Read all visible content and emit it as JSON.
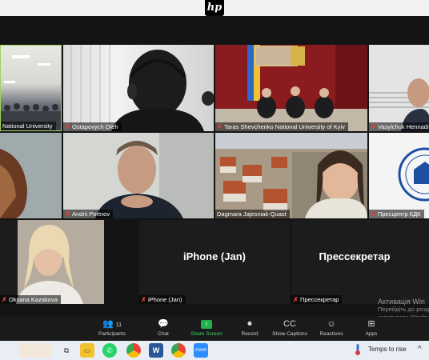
{
  "participants": {
    "p1": {
      "name": "National University"
    },
    "p2": {
      "name": "Ostapovych Oleh"
    },
    "p3": {
      "name": "Taras Shevchenko National University of Kyiv"
    },
    "p4": {
      "name": "Vasylchuk Hennadi"
    },
    "p5": {
      "name": ""
    },
    "p6": {
      "name": "Andrii Portnov"
    },
    "p7": {
      "name": "Dagmara Jajesniak-Quast"
    },
    "p8": {
      "name": "Пресцентр КДК"
    },
    "p9": {
      "name": "Oksana Kazakova"
    },
    "p10": {
      "name": "iPhone (Jan)",
      "big": "iPhone (Jan)"
    },
    "p11": {
      "name": "Прессекретар",
      "big": "Прессекретар"
    }
  },
  "toolbar": {
    "participants_count": "11",
    "participants": "Participants",
    "chat": "Chat",
    "share": "Share Screen",
    "record": "Record",
    "captions": "Show Captions",
    "reactions": "Reactions",
    "apps": "Apps"
  },
  "activation": {
    "title": "Активація Win",
    "line1": "Перейдіть до розділу",
    "line2": "активувати Windows."
  },
  "taskbar": {
    "weather": "Temps to rise"
  },
  "colors": {
    "share_green": "#21b04b",
    "active_speaker": "#9fd35a",
    "mic_muted": "#e0433a"
  }
}
